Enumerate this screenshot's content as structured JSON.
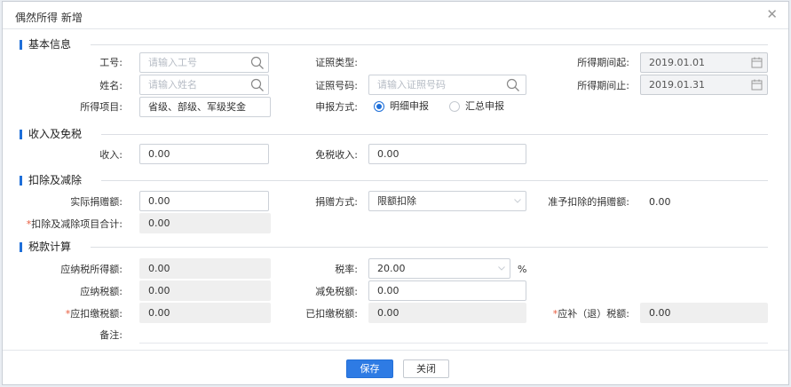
{
  "dialog": {
    "title": "偶然所得 新增",
    "close_glyph": "✕"
  },
  "sections": {
    "basic": "基本信息",
    "income": "收入及免税",
    "deduction": "扣除及减除",
    "tax": "税款计算"
  },
  "basic": {
    "employee_id": {
      "label": "工号:",
      "placeholder": "请输入工号"
    },
    "name": {
      "label": "姓名:",
      "placeholder": "请输入姓名"
    },
    "income_item": {
      "label": "所得项目:",
      "value": "省级、部级、军级奖金"
    },
    "id_type": {
      "label": "证照类型:"
    },
    "id_number": {
      "label": "证照号码:",
      "placeholder": "请输入证照号码"
    },
    "report_method": {
      "label": "申报方式:",
      "options": [
        "明细申报",
        "汇总申报"
      ],
      "selected": "明细申报"
    },
    "period_start": {
      "label": "所得期间起:",
      "value": "2019.01.01"
    },
    "period_end": {
      "label": "所得期间止:",
      "value": "2019.01.31"
    }
  },
  "income": {
    "income": {
      "label": "收入:",
      "value": "0.00"
    },
    "tax_free_income": {
      "label": "免税收入:",
      "value": "0.00"
    }
  },
  "deduction": {
    "actual_donation": {
      "label": "实际捐赠额:",
      "value": "0.00"
    },
    "donation_method": {
      "label": "捐赠方式:",
      "value": "限额扣除"
    },
    "allowed_donation": {
      "label": "准予扣除的捐赠额:",
      "value": "0.00"
    },
    "total_deduction": {
      "required": "*",
      "label": "扣除及减除项目合计:",
      "value": "0.00"
    }
  },
  "tax": {
    "taxable_income": {
      "label": "应纳税所得额:",
      "value": "0.00"
    },
    "tax_rate": {
      "label": "税率:",
      "value": "20.00",
      "unit": "%"
    },
    "tax_payable": {
      "label": "应纳税额:",
      "value": "0.00"
    },
    "tax_reduction": {
      "label": "减免税额:",
      "value": "0.00"
    },
    "tax_withheld": {
      "required": "*",
      "label": "应扣缴税额:",
      "value": "0.00"
    },
    "tax_already_paid": {
      "label": "已扣缴税额:",
      "value": "0.00"
    },
    "tax_refund": {
      "required": "*",
      "label": "应补（退）税额:",
      "value": "0.00"
    },
    "remark": {
      "label": "备注:"
    }
  },
  "footer": {
    "save": "保存",
    "close": "关闭"
  },
  "colors": {
    "accent": "#1e6fd9",
    "primary_button": "#2e7be4",
    "required": "#e85a3c"
  }
}
